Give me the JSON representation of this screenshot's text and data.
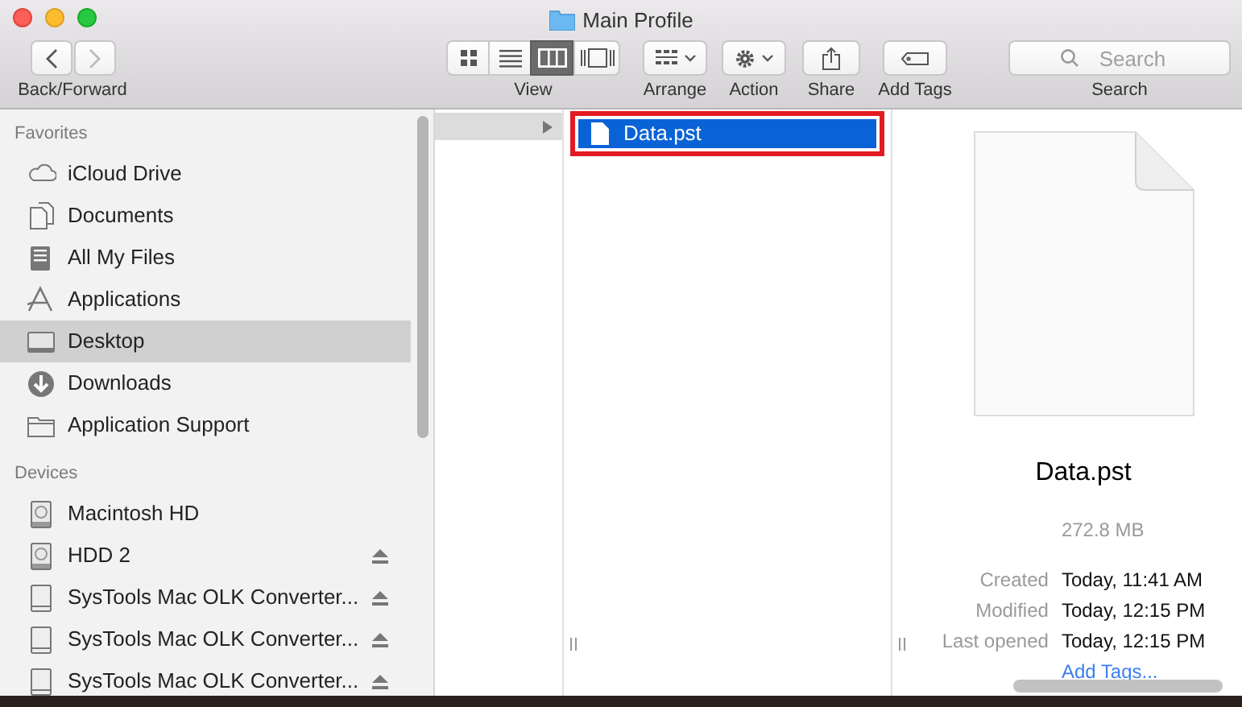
{
  "window": {
    "title": "Main Profile"
  },
  "toolbar": {
    "groups": [
      {
        "kind": "nav",
        "label": "Back/Forward"
      },
      {
        "kind": "view",
        "label": "View",
        "modes": [
          {
            "kind": "grid",
            "selected": false
          },
          {
            "kind": "list",
            "selected": false
          },
          {
            "kind": "columns",
            "selected": true
          },
          {
            "kind": "gallery",
            "selected": false
          }
        ]
      },
      {
        "kind": "arrange",
        "label": "Arrange"
      },
      {
        "kind": "action",
        "label": "Action"
      },
      {
        "kind": "share",
        "label": "Share"
      },
      {
        "kind": "tags",
        "label": "Add Tags"
      },
      {
        "kind": "search",
        "label": "Search",
        "placeholder": "Search"
      }
    ]
  },
  "sidebar": {
    "sections": [
      {
        "title": "Favorites",
        "items": [
          {
            "kind": "cloud",
            "label": "iCloud Drive",
            "selected": false,
            "eject": false
          },
          {
            "kind": "document",
            "label": "Documents",
            "selected": false,
            "eject": false
          },
          {
            "kind": "files",
            "label": "All My Files",
            "selected": false,
            "eject": false
          },
          {
            "kind": "apps",
            "label": "Applications",
            "selected": false,
            "eject": false
          },
          {
            "kind": "desktop",
            "label": "Desktop",
            "selected": true,
            "eject": false
          },
          {
            "kind": "download",
            "label": "Downloads",
            "selected": false,
            "eject": false
          },
          {
            "kind": "folder",
            "label": "Application Support",
            "selected": false,
            "eject": false
          }
        ]
      },
      {
        "title": "Devices",
        "items": [
          {
            "kind": "disk",
            "label": "Macintosh HD",
            "selected": false,
            "eject": false
          },
          {
            "kind": "disk",
            "label": "HDD 2",
            "selected": false,
            "eject": true
          },
          {
            "kind": "drive",
            "label": "SysTools Mac OLK Converter...",
            "selected": false,
            "eject": true
          },
          {
            "kind": "drive",
            "label": "SysTools Mac OLK Converter...",
            "selected": false,
            "eject": true
          },
          {
            "kind": "drive",
            "label": "SysTools Mac OLK Converter...",
            "selected": false,
            "eject": true
          }
        ]
      }
    ]
  },
  "column_1": {
    "rows": [
      {
        "selected": true
      }
    ]
  },
  "column_2": {
    "rows": [
      {
        "name": "Data.pst",
        "selected": true,
        "highlighted": true
      }
    ]
  },
  "preview": {
    "name": "Data.pst",
    "size": "272.8 MB",
    "details": [
      {
        "label": "Created",
        "value": "Today, 11:41 AM"
      },
      {
        "label": "Modified",
        "value": "Today, 12:15 PM"
      },
      {
        "label": "Last opened",
        "value": "Today, 12:15 PM"
      }
    ],
    "add_tags": "Add Tags..."
  }
}
